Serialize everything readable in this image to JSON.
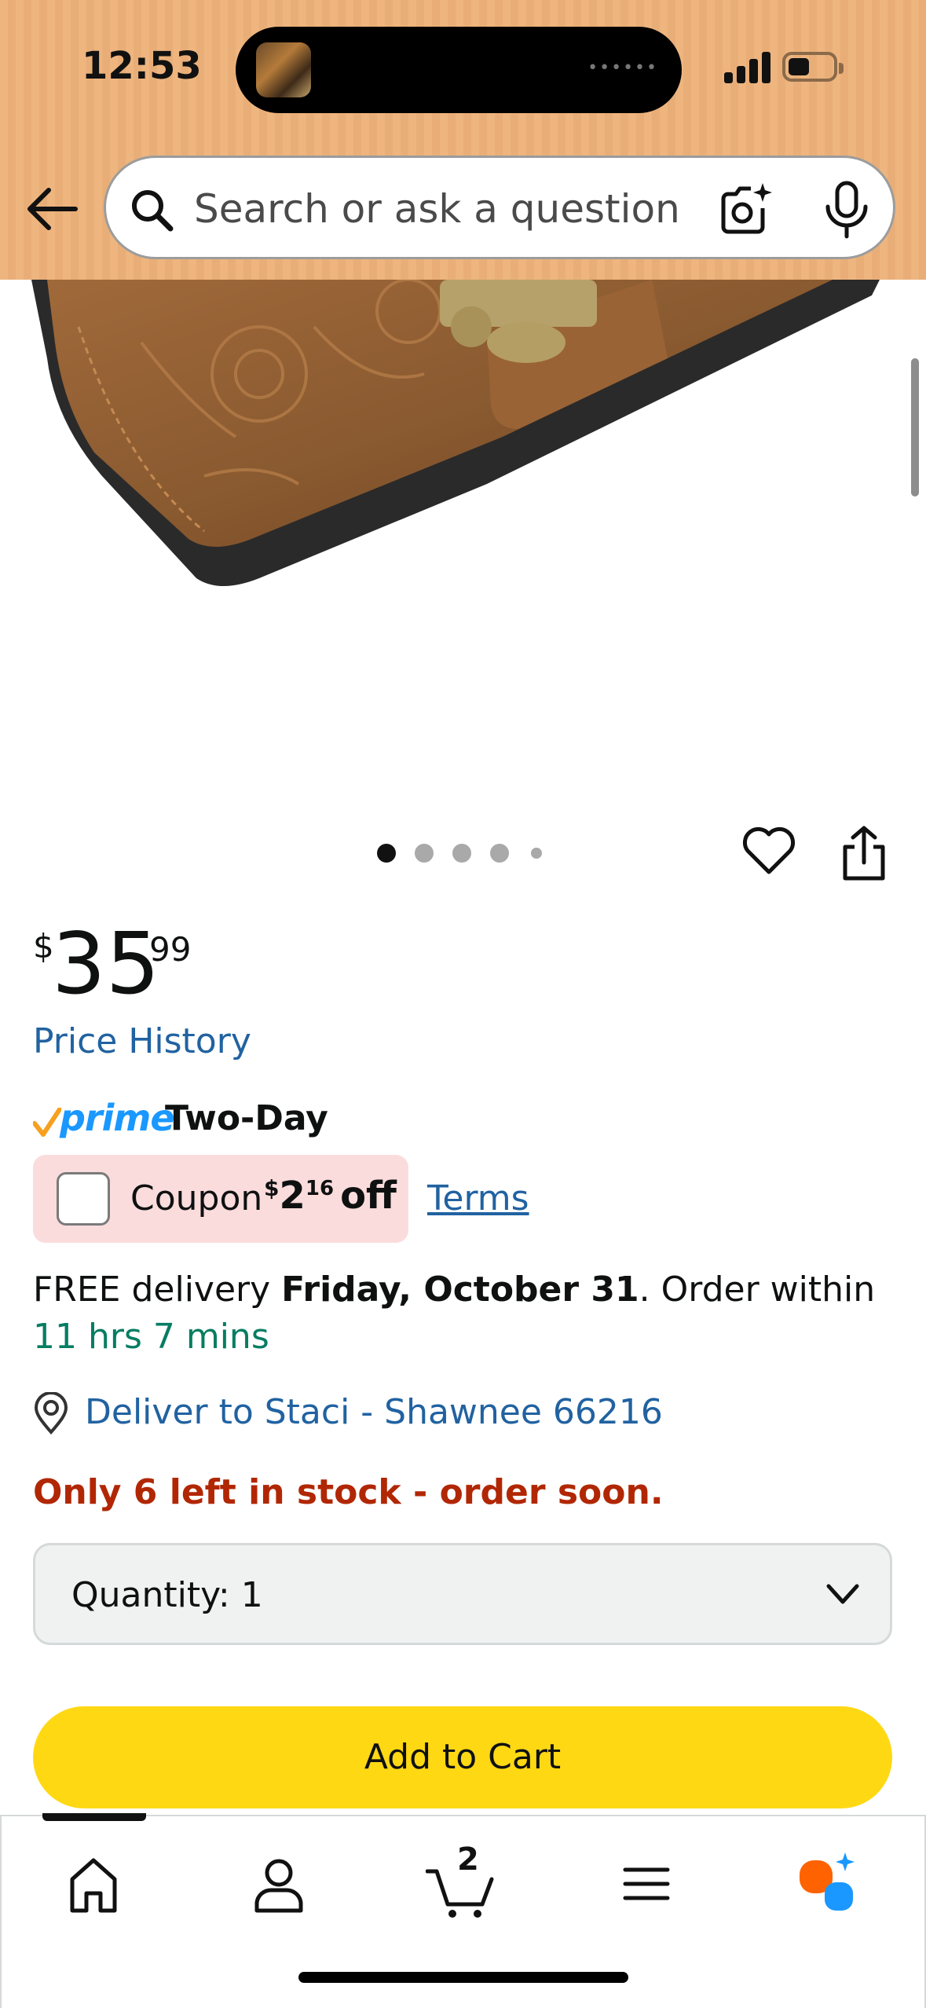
{
  "status_bar": {
    "time": "12:53"
  },
  "search": {
    "placeholder": "Search or ask a question"
  },
  "gallery": {
    "image_count": 5,
    "active_index": 0
  },
  "price": {
    "symbol": "$",
    "whole": "35",
    "fraction": "99"
  },
  "price_history_label": "Price History",
  "prime": {
    "word": "prime",
    "speed": "Two-Day"
  },
  "coupon": {
    "label": "Coupon",
    "symbol": "$",
    "whole": "2",
    "fraction": "16",
    "off": "off",
    "terms": "Terms"
  },
  "delivery": {
    "prefix": "FREE delivery ",
    "date": "Friday, October 31",
    "middle": ". Order within ",
    "countdown": "11 hrs 7 mins"
  },
  "location": {
    "text": "Deliver to Staci - Shawnee 66216"
  },
  "stock_warning": "Only 6 left in stock - order soon.",
  "quantity": {
    "label": "Quantity:",
    "value": "1"
  },
  "add_to_cart": "Add to Cart",
  "bottom_nav": {
    "cart_count": "2",
    "items": [
      "home",
      "account",
      "cart",
      "menu",
      "rufus"
    ]
  },
  "colors": {
    "header_bg": "#eeb57f",
    "link": "#2162a1",
    "countdown_green": "#067d62",
    "stock_red": "#b12704",
    "cart_button": "#ffd814",
    "prime_blue": "#1a98ff",
    "coupon_bg": "#fbdcdc"
  }
}
